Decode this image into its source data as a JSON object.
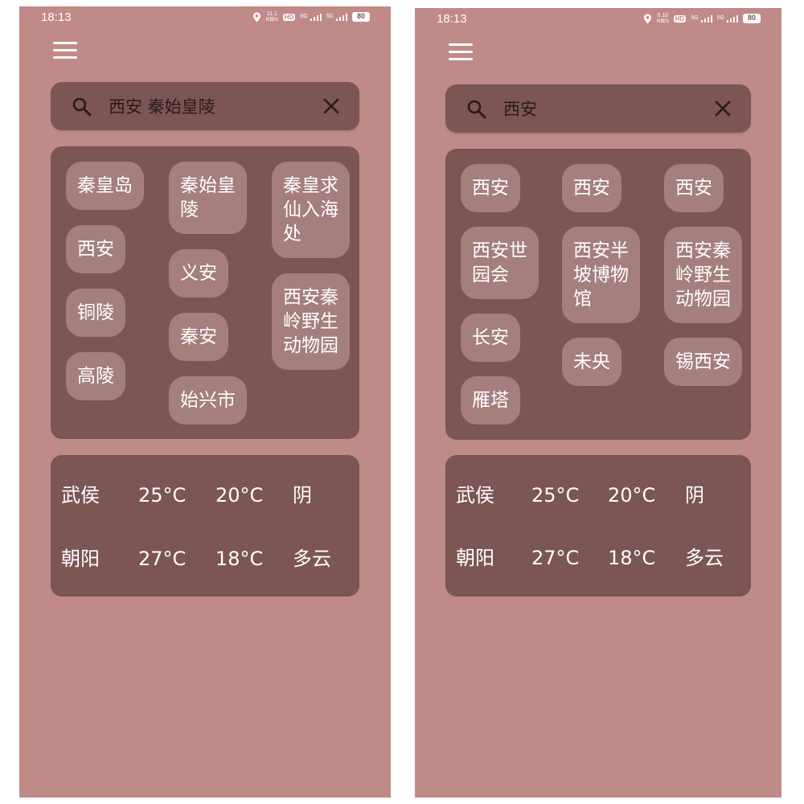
{
  "left": {
    "status": {
      "time": "18:13",
      "net_speed_value": "11.1",
      "net_speed_unit": "KB/s",
      "hd": "HD",
      "signal_1": "5G",
      "signal_2": "5G",
      "battery": "80"
    },
    "search": {
      "value": "西安 秦始皇陵"
    },
    "suggestions": [
      "秦皇岛",
      "西安",
      "铜陵",
      "高陵",
      "秦始皇\n陵",
      "义安",
      "秦安",
      "始兴市",
      "秦皇求\n仙入海\n处",
      "西安秦\n岭野生\n动物园"
    ],
    "weather": [
      {
        "city": "武侯",
        "high": "25°C",
        "low": "20°C",
        "cond": "阴"
      },
      {
        "city": "朝阳",
        "high": "27°C",
        "low": "18°C",
        "cond": "多云"
      }
    ]
  },
  "right": {
    "status": {
      "time": "18:13",
      "net_speed_value": "0.10",
      "net_speed_unit": "KB/s",
      "hd": "HD",
      "signal_1": "5G",
      "signal_2": "5G",
      "battery": "80"
    },
    "search": {
      "value": "西安"
    },
    "suggestions": [
      "西安",
      "西安世\n园会",
      "长安",
      "雁塔",
      "西安",
      "西安半\n坡博物\n馆",
      "未央",
      "西安",
      "西安秦\n岭野生\n动物园",
      "锡西安"
    ],
    "weather": [
      {
        "city": "武侯",
        "high": "25°C",
        "low": "20°C",
        "cond": "阴"
      },
      {
        "city": "朝阳",
        "high": "27°C",
        "low": "18°C",
        "cond": "多云"
      }
    ]
  },
  "colors": {
    "background": "#c08a88",
    "panel": "#7c5555",
    "chip": "#a57e7e",
    "text": "#ffffff"
  },
  "icons": [
    "menu-icon",
    "search-icon",
    "close-icon",
    "location-icon",
    "battery-icon",
    "signal-icon"
  ]
}
